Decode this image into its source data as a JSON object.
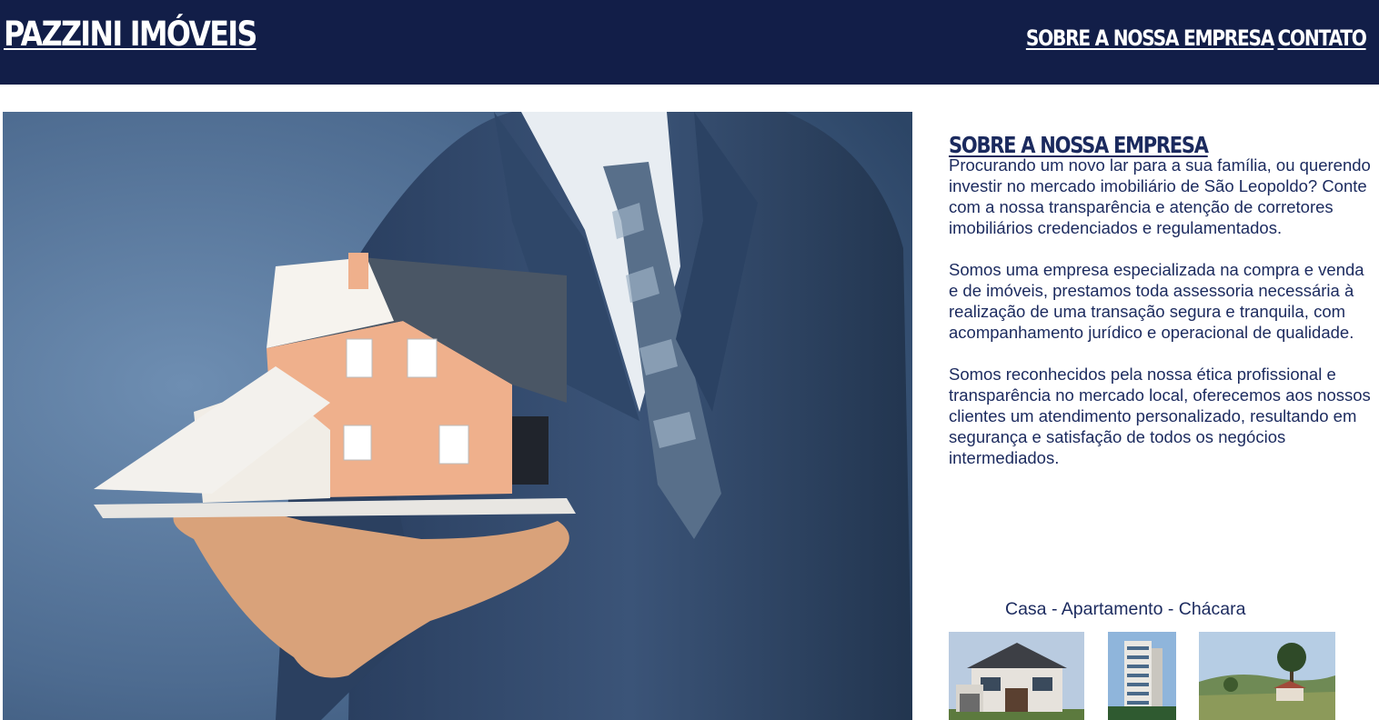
{
  "header": {
    "logo": "PAZZINI IMÓVEIS",
    "nav": [
      {
        "label": "SOBRE A NOSSA EMPRESA"
      },
      {
        "label": "CONTATO"
      }
    ],
    "background": "#121e48"
  },
  "about": {
    "title": "SOBRE A NOSSA EMPRESA",
    "paragraphs": [
      "Procurando um novo lar para a sua família, ou querendo investir no mercado imobiliário de São Leopoldo? Conte com a nossa transparência e atenção de corretores imobiliários credenciados e regulamentados.",
      "Somos uma empresa especializada na compra e venda e de imóveis, prestamos toda assessoria necessária à realização de uma transação segura e tranquila, com acompanhamento jurídico e operacional de qualidade.",
      "Somos reconhecidos pela nossa ética profissional e transparência no mercado local, oferecemos aos nossos clientes um atendimento personalizado, resultando em segurança e satisfação de todos os negócios intermediados."
    ],
    "text_color": "#1b2a5e"
  },
  "property_types": {
    "caption": "Casa - Apartamento - Chácara"
  }
}
